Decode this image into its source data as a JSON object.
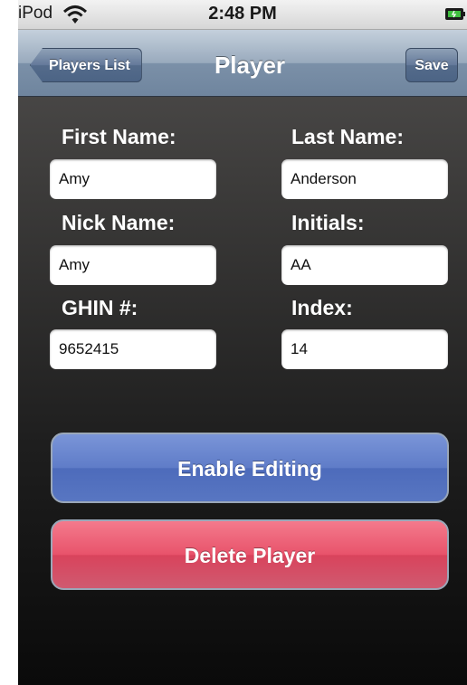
{
  "status_bar": {
    "carrier": "iPod",
    "time": "2:48 PM",
    "wifi_icon": "wifi-icon",
    "battery_icon": "battery-icon"
  },
  "nav_bar": {
    "back_label": "Players List",
    "title": "Player",
    "save_label": "Save"
  },
  "form": {
    "first_name": {
      "label": "First Name:",
      "value": "Amy"
    },
    "last_name": {
      "label": "Last Name:",
      "value": "Anderson"
    },
    "nick_name": {
      "label": "Nick Name:",
      "value": "Amy"
    },
    "initials": {
      "label": "Initials:",
      "value": "AA"
    },
    "ghin": {
      "label": "GHIN #:",
      "value": "9652415"
    },
    "index": {
      "label": "Index:",
      "value": "14"
    }
  },
  "actions": {
    "enable_editing_label": "Enable Editing",
    "delete_player_label": "Delete Player"
  },
  "colors": {
    "enable_button": "#5f7cc8",
    "delete_button": "#e8536b",
    "navbar": "#8a9db3"
  }
}
